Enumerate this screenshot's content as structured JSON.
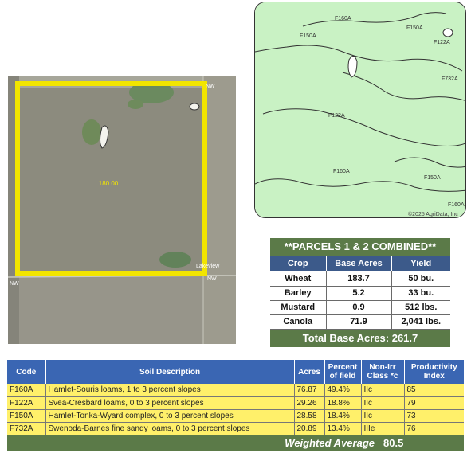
{
  "aerial": {
    "road_labels": [
      "NW",
      "Lakeview",
      "NW",
      "NW"
    ],
    "tract_acres_label": "180.00"
  },
  "soil_map": {
    "labels": [
      "F160A",
      "F150A",
      "F122A",
      "F150A",
      "F732A",
      "F122A",
      "F160A",
      "F150A",
      "F160A"
    ],
    "copyright": "©2025 AgriData, Inc"
  },
  "parcels": {
    "title": "**PARCELS 1 & 2 COMBINED**",
    "headers": [
      "Crop",
      "Base Acres",
      "Yield"
    ],
    "rows": [
      [
        "Wheat",
        "183.7",
        "50 bu."
      ],
      [
        "Barley",
        "5.2",
        "33 bu."
      ],
      [
        "Mustard",
        "0.9",
        "512 lbs."
      ],
      [
        "Canola",
        "71.9",
        "2,041 lbs."
      ]
    ],
    "total": "Total Base Acres:  261.7"
  },
  "soils": {
    "headers": [
      "Code",
      "Soil Description",
      "Acres",
      "Percent of field",
      "Non-Irr Class *c",
      "Productivity Index"
    ],
    "rows": [
      [
        "F160A",
        "Hamlet-Souris loams, 1 to 3 percent slopes",
        "76.87",
        "49.4%",
        "IIc",
        "85"
      ],
      [
        "F122A",
        "Svea-Cresbard loams, 0 to 3 percent slopes",
        "29.26",
        "18.8%",
        "IIc",
        "79"
      ],
      [
        "F150A",
        "Hamlet-Tonka-Wyard complex, 0 to 3 percent slopes",
        "28.58",
        "18.4%",
        "IIc",
        "73"
      ],
      [
        "F732A",
        "Swenoda-Barnes fine sandy loams, 0 to 3 percent slopes",
        "20.89",
        "13.4%",
        "IIIe",
        "76"
      ]
    ],
    "weighted_label": "Weighted Average",
    "weighted_value": "80.5"
  }
}
